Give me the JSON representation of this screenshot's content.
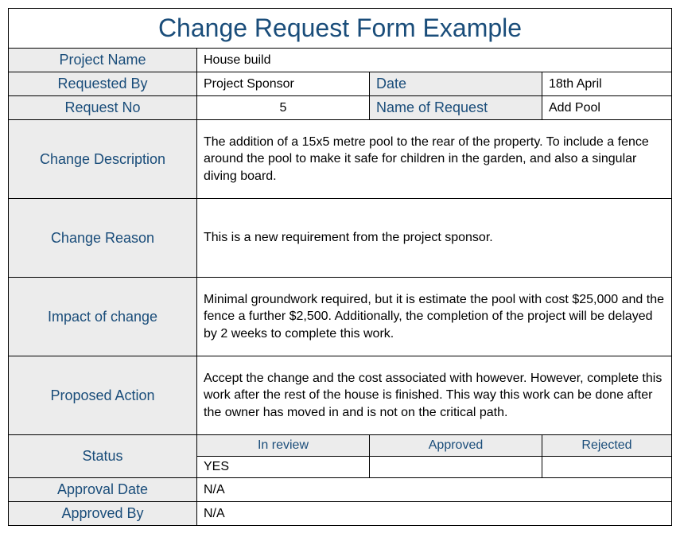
{
  "title": "Change Request Form Example",
  "fields": {
    "project_name_label": "Project Name",
    "project_name_value": "House build",
    "requested_by_label": "Requested By",
    "requested_by_value": "Project Sponsor",
    "date_label": "Date",
    "date_value": "18th April",
    "request_no_label": "Request No",
    "request_no_value": "5",
    "name_of_request_label": "Name of Request",
    "name_of_request_value": "Add Pool",
    "change_description_label": "Change Description",
    "change_description_value": "The addition of a 15x5 metre pool to the rear of the property. To include a fence around the pool to make it safe for children in the garden, and also a singular diving board.",
    "change_reason_label": "Change Reason",
    "change_reason_value": "This is a new requirement from the project sponsor.",
    "impact_label": "Impact of change",
    "impact_value": "Minimal groundwork required, but it is estimate the pool with cost $25,000 and the fence a further $2,500. Additionally, the completion of the project will be delayed by 2 weeks to complete this work.",
    "proposed_action_label": "Proposed Action",
    "proposed_action_value": "Accept the change and the cost associated with however. However, complete this work after the rest of the house is finished. This way this work can be done after the owner has moved in and is not on the critical path.",
    "status_label": "Status",
    "status_in_review_label": "In review",
    "status_approved_label": "Approved",
    "status_rejected_label": "Rejected",
    "status_in_review_value": "YES",
    "status_approved_value": "",
    "status_rejected_value": "",
    "approval_date_label": "Approval Date",
    "approval_date_value": "N/A",
    "approved_by_label": "Approved By",
    "approved_by_value": "N/A"
  }
}
